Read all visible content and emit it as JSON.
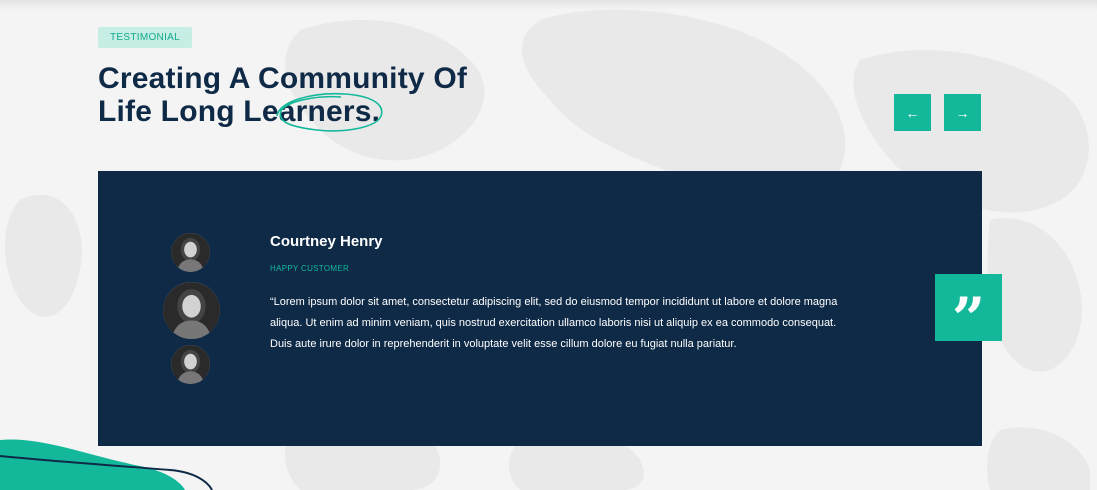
{
  "section": {
    "badge": "TESTIMONIAL",
    "title_line1": "Creating A Community Of",
    "title_line2_prefix": "Life Long Le",
    "title_line2_highlight": "arners",
    "title_line2_suffix": "."
  },
  "nav": {
    "prev_icon": "arrow-left-icon",
    "next_icon": "arrow-right-icon",
    "prev_glyph": "←",
    "next_glyph": "→"
  },
  "testimonial": {
    "name": "Courtney Henry",
    "role": "HAPPY CUSTOMER",
    "quote": "“Lorem ipsum dolor sit amet, consectetur adipiscing elit, sed do eiusmod tempor incididunt ut labore et dolore magna aliqua. Ut enim ad minim veniam, quis nostrud exercitation ullamco laboris nisi ut aliquip ex ea commodo consequat. Duis aute irure dolor in reprehenderit in voluptate velit esse cillum dolore eu fugiat nulla pariatur.",
    "quote_icon": "quote-icon",
    "quote_glyph": "”"
  },
  "colors": {
    "accent": "#13b89a",
    "navy": "#0f2a47",
    "badge_bg": "#c6eee4",
    "background": "#f4f4f4"
  }
}
